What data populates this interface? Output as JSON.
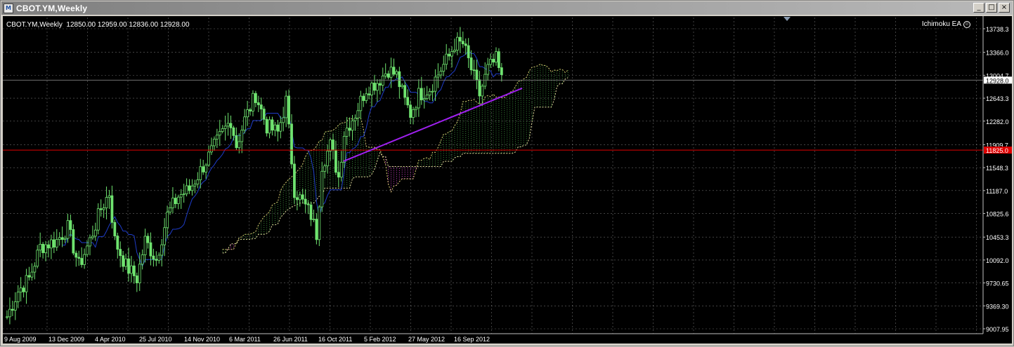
{
  "window": {
    "title": "CBOT.YM,Weekly",
    "app_icon_glyph": "M",
    "buttons": {
      "minimize": "_",
      "maximize": "□",
      "close": "×"
    }
  },
  "chart_info": {
    "text": "CBOT.YM,Weekly  12850.00 12959.00 12836.00 12928.00",
    "symbol": "CBOT.YM",
    "timeframe": "Weekly",
    "open": 12850.0,
    "high": 12959.0,
    "low": 12836.0,
    "close": 12928.0
  },
  "indicator": {
    "name": "Ichimoku EA",
    "icon": "smiley-icon"
  },
  "colors": {
    "background": "#000000",
    "grid": "#c0c0c0",
    "candles": "#6fe36f",
    "tenkan_blue": "#1e3cc8",
    "senkou_a": "#d8c870",
    "senkou_b": "#e8e0a0",
    "cloud_bull": "#3a8a3a",
    "cloud_bear": "#d040c8",
    "trendline": "#a020f0",
    "support_line": "#e00000",
    "price_label_bg": "#e00000"
  },
  "chart_data": {
    "type": "candlestick",
    "timeframe": "Weekly",
    "x_ticks": [
      "9 Aug 2009",
      "13 Dec 2009",
      "4 Apr 2010",
      "25 Jul 2010",
      "14 Nov 2010",
      "6 Mar 2011",
      "26 Jun 2011",
      "16 Oct 2011",
      "5 Feb 2012",
      "27 May 2012",
      "16 Sep 2012"
    ],
    "y_ticks": [
      "13738.3",
      "13366.0",
      "13004.7",
      "12643.3",
      "12282.0",
      "11909.7",
      "11548.3",
      "11187.0",
      "10825.6",
      "10453.3",
      "10092.0",
      "9730.65",
      "9369.30",
      "9007.95"
    ],
    "ylim": [
      9007.95,
      13738.3
    ],
    "current_price": "12928.0",
    "horizontal_line": {
      "price": "11825.0",
      "label": "11825.0"
    },
    "trendline": {
      "from": {
        "date": "Oct 2011",
        "price": 11650
      },
      "to": {
        "date": "Dec 2012",
        "price": 12800
      }
    },
    "close_path": [
      [
        "2009-08-09",
        9200
      ],
      [
        "2009-09-06",
        9600
      ],
      [
        "2009-10-04",
        9800
      ],
      [
        "2009-11-01",
        10300
      ],
      [
        "2009-12-13",
        10400
      ],
      [
        "2010-01-10",
        10600
      ],
      [
        "2010-02-07",
        10000
      ],
      [
        "2010-03-07",
        10400
      ],
      [
        "2010-04-04",
        10900
      ],
      [
        "2010-04-25",
        11150
      ],
      [
        "2010-05-09",
        10400
      ],
      [
        "2010-06-06",
        10000
      ],
      [
        "2010-07-04",
        9800
      ],
      [
        "2010-07-25",
        10400
      ],
      [
        "2010-08-22",
        10100
      ],
      [
        "2010-09-19",
        10800
      ],
      [
        "2010-10-17",
        11100
      ],
      [
        "2010-11-14",
        11200
      ],
      [
        "2010-12-12",
        11500
      ],
      [
        "2011-01-09",
        11800
      ],
      [
        "2011-02-06",
        12100
      ],
      [
        "2011-02-27",
        12300
      ],
      [
        "2011-03-13",
        11900
      ],
      [
        "2011-04-03",
        12300
      ],
      [
        "2011-05-01",
        12700
      ],
      [
        "2011-05-29",
        12200
      ],
      [
        "2011-06-26",
        12100
      ],
      [
        "2011-07-17",
        12600
      ],
      [
        "2011-08-07",
        11200
      ],
      [
        "2011-08-28",
        11000
      ],
      [
        "2011-09-18",
        10800
      ],
      [
        "2011-10-02",
        10500
      ],
      [
        "2011-10-16",
        11600
      ],
      [
        "2011-11-06",
        11900
      ],
      [
        "2011-11-27",
        11400
      ],
      [
        "2011-12-11",
        12100
      ],
      [
        "2012-01-08",
        12400
      ],
      [
        "2012-02-05",
        12800
      ],
      [
        "2012-03-04",
        12900
      ],
      [
        "2012-04-01",
        13100
      ],
      [
        "2012-04-22",
        13000
      ],
      [
        "2012-05-13",
        12600
      ],
      [
        "2012-05-27",
        12400
      ],
      [
        "2012-06-17",
        12700
      ],
      [
        "2012-07-15",
        12800
      ],
      [
        "2012-08-12",
        13100
      ],
      [
        "2012-09-02",
        13300
      ],
      [
        "2012-09-16",
        13500
      ],
      [
        "2012-10-07",
        13500
      ],
      [
        "2012-10-28",
        13100
      ],
      [
        "2012-11-18",
        12700
      ],
      [
        "2012-12-09",
        13100
      ],
      [
        "2012-12-30",
        13250
      ],
      [
        "2013-01-13",
        12928
      ]
    ]
  }
}
